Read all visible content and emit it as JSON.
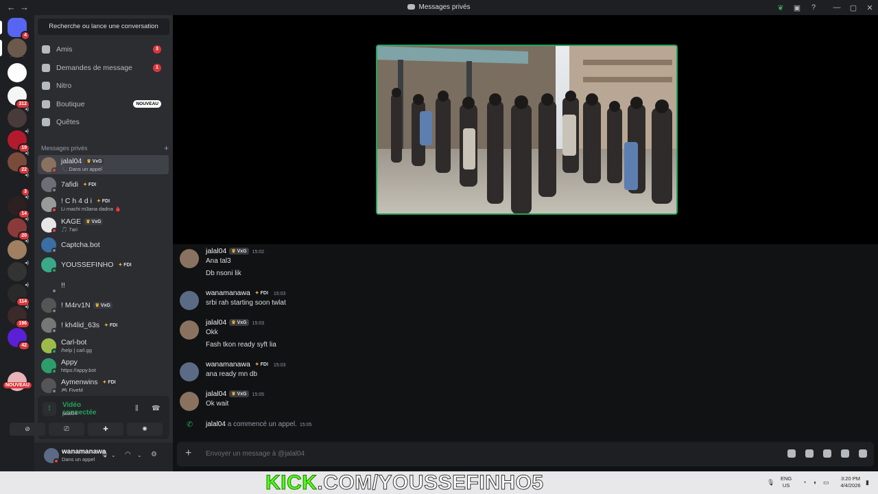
{
  "window": {
    "title": "Messages privés"
  },
  "guilds": [
    {
      "badge": "4",
      "color": "#5865f2"
    },
    {
      "badge": "",
      "color": "#6b5a4c"
    },
    {
      "badge": "",
      "color": "#ffffff"
    },
    {
      "badge": "312",
      "color": "#f5f5f5"
    },
    {
      "badge": "",
      "color": "#4a3b3b"
    },
    {
      "badge": "19",
      "color": "#b31b2c"
    },
    {
      "badge": "22",
      "color": "#7a4b3a"
    },
    {
      "badge": "3",
      "color": "#1e1f22"
    },
    {
      "badge": "14",
      "color": "#2d2020"
    },
    {
      "badge": "20",
      "color": "#8b3a3a"
    },
    {
      "badge": "",
      "color": "#a08060"
    },
    {
      "badge": "",
      "color": "#333333"
    },
    {
      "badge": "114",
      "color": "#2a2a2a"
    },
    {
      "badge": "196",
      "color": "#3a2a2a"
    },
    {
      "badge": "42",
      "color": "#5b1fd6"
    },
    {
      "badge": "",
      "color": "#1e1f22"
    },
    {
      "badge": "",
      "color": "#e8b4b8"
    }
  ],
  "guild_new_label": "NOUVEAU",
  "search": {
    "label": "Recherche ou lance une conversation"
  },
  "nav": [
    {
      "label": "Amis",
      "count": "3",
      "new": ""
    },
    {
      "label": "Demandes de message",
      "count": "1",
      "new": ""
    },
    {
      "label": "Nitro",
      "count": "",
      "new": ""
    },
    {
      "label": "Boutique",
      "count": "",
      "new": "NOUVEAU"
    },
    {
      "label": "Quêtes",
      "count": "",
      "new": ""
    }
  ],
  "dm_header": "Messages privés",
  "dms": [
    {
      "name": "jalal04",
      "tag": "VxG",
      "sub": "📞 Dans un appel",
      "status": "#f23f43",
      "color": "#8a7260",
      "active": true
    },
    {
      "name": "7afidi",
      "tag": "FDI",
      "sub": "",
      "status": "#80848e",
      "color": "#6c6f76",
      "active": false
    },
    {
      "name": "! C h 4 d i",
      "tag": "FDI",
      "sub": "Li machi m3ana dadna 🩸",
      "status": "#f23f43",
      "color": "#9a9a9a",
      "active": false
    },
    {
      "name": "KAGE",
      "tag": "VxG",
      "sub": "🎵 7ari",
      "status": "#f23f43",
      "color": "#e6e6e6",
      "active": false
    },
    {
      "name": "Captcha.bot",
      "tag": "",
      "sub": "",
      "status": "#80848e",
      "color": "#3a6ea5",
      "active": false
    },
    {
      "name": "YOUSSEFINHO",
      "tag": "FDI",
      "sub": "",
      "status": "#23a55a",
      "color": "#3aa889",
      "active": false
    },
    {
      "name": "!!",
      "tag": "",
      "sub": "",
      "status": "#80848e",
      "color": "#2b2d31",
      "active": false
    },
    {
      "name": "! M4rv1N",
      "tag": "VxG",
      "sub": "",
      "status": "#80848e",
      "color": "#555555",
      "active": false
    },
    {
      "name": "! kh4lid_63s",
      "tag": "FDI",
      "sub": "",
      "status": "#80848e",
      "color": "#777777",
      "active": false
    },
    {
      "name": "Carl-bot",
      "tag": "",
      "sub": "/help | carl.gg",
      "status": "#23a55a",
      "color": "#9dbb4a",
      "active": false
    },
    {
      "name": "Appy",
      "tag": "",
      "sub": "https://appy.bot",
      "status": "#23a55a",
      "color": "#2e9d6c",
      "active": false
    },
    {
      "name": "Aymenwins",
      "tag": "FDI",
      "sub": "🎮 FiveM",
      "status": "#80848e",
      "color": "#555555",
      "active": false
    }
  ],
  "voice": {
    "status": "Vidéo connectée",
    "channel": "jalal04"
  },
  "user": {
    "name": "wanamanawa",
    "status": "Dans un appel"
  },
  "messages": [
    {
      "author": "jalal04",
      "tag": "VxG",
      "time": "15:02",
      "lines": [
        "Ana tal3",
        "Db nsoni lik"
      ],
      "color": "#8a7260"
    },
    {
      "author": "wanamanawa",
      "tag": "FDI",
      "time": "15:03",
      "lines": [
        "srbi rah starting soon twlat"
      ],
      "color": "#5b6b85"
    },
    {
      "author": "jalal04",
      "tag": "VxG",
      "time": "15:03",
      "lines": [
        "Okk",
        "Fash tkon ready syft lia"
      ],
      "color": "#8a7260"
    },
    {
      "author": "wanamanawa",
      "tag": "FDI",
      "time": "15:03",
      "lines": [
        "ana ready mn db"
      ],
      "color": "#5b6b85"
    },
    {
      "author": "jalal04",
      "tag": "VxG",
      "time": "15:05",
      "lines": [
        "Ok wait"
      ],
      "color": "#8a7260"
    }
  ],
  "call_event": {
    "author": "jalal04",
    "text": "a commencé un appel.",
    "time": "15:05"
  },
  "composer": {
    "placeholder": "Envoyer un message à @jalal04"
  },
  "taskbar": {
    "watermark_k": "KICK",
    "watermark_rest": ".COM/YOUSSEFINHO5",
    "lang": "ENG",
    "region": "US",
    "time": "3:20 PM",
    "date": "4/4/2026"
  }
}
